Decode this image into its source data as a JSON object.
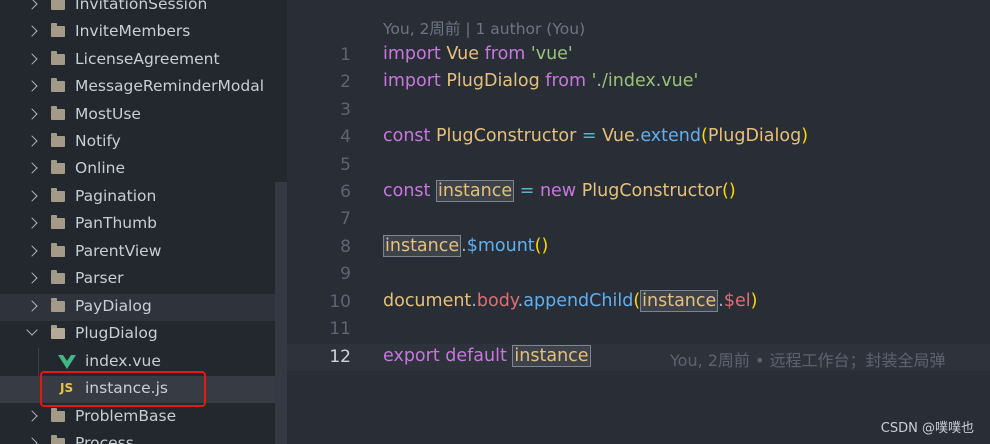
{
  "explorer": {
    "items": [
      {
        "label": "InvitationSession",
        "kind": "folder"
      },
      {
        "label": "InviteMembers",
        "kind": "folder"
      },
      {
        "label": "LicenseAgreement",
        "kind": "folder"
      },
      {
        "label": "MessageReminderModal",
        "kind": "folder"
      },
      {
        "label": "MostUse",
        "kind": "folder"
      },
      {
        "label": "Notify",
        "kind": "folder"
      },
      {
        "label": "Online",
        "kind": "folder"
      },
      {
        "label": "Pagination",
        "kind": "folder"
      },
      {
        "label": "PanThumb",
        "kind": "folder"
      },
      {
        "label": "ParentView",
        "kind": "folder"
      },
      {
        "label": "Parser",
        "kind": "folder"
      },
      {
        "label": "PayDialog",
        "kind": "folder"
      },
      {
        "label": "PlugDialog",
        "kind": "folder-open"
      },
      {
        "label": "index.vue",
        "kind": "vue-file"
      },
      {
        "label": "instance.js",
        "kind": "js-file"
      },
      {
        "label": "ProblemBase",
        "kind": "folder"
      },
      {
        "label": "Process",
        "kind": "folder"
      }
    ],
    "js_badge": "JS"
  },
  "editor": {
    "blame_header": "You, 2周前 | 1 author (You)",
    "line_numbers": [
      "1",
      "2",
      "3",
      "4",
      "5",
      "6",
      "7",
      "8",
      "9",
      "10",
      "11",
      "12"
    ],
    "active_line": 12,
    "tokens": {
      "import": "import",
      "from": "from",
      "const": "const",
      "new": "new",
      "export": "export",
      "default": "default",
      "Vue": "Vue",
      "vue_str": "'vue'",
      "PlugDialog": "PlugDialog",
      "index_str": "'./index.vue'",
      "PlugConstructor": "PlugConstructor",
      "eq": "=",
      "dot": ".",
      "extend": "extend",
      "lparen": "(",
      "rparen": ")",
      "parens": "()",
      "instance": "instance",
      "mount": "$mount",
      "document": "document",
      "body": "body",
      "appendChild": "appendChild",
      "el": "$el"
    },
    "inline_blame": "You, 2周前 • 远程工作台；封装全局弹"
  },
  "watermark": "CSDN @噗噗也"
}
